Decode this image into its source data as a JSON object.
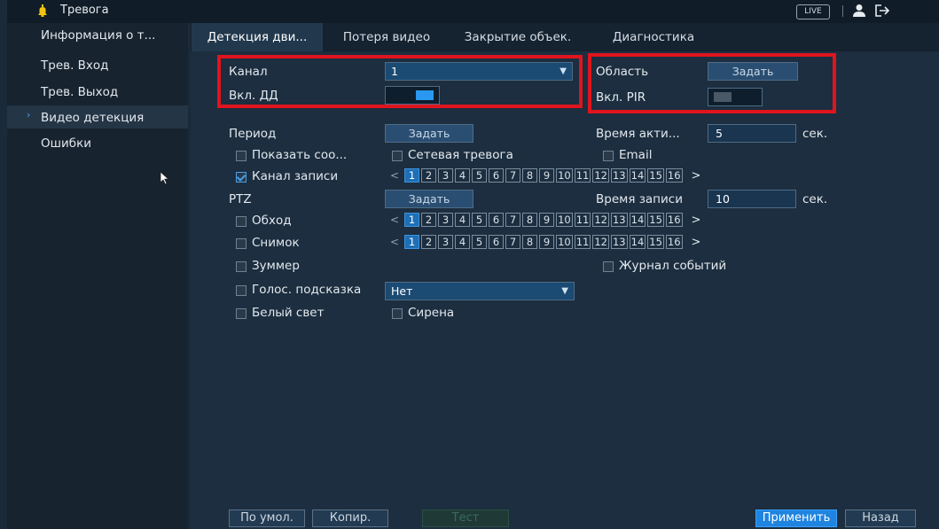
{
  "header": {
    "title": "Тревога",
    "live_label": "LIVE",
    "bell_icon": "bell-icon",
    "user_icon": "user-icon",
    "logout_icon": "logout-icon"
  },
  "sidebar": {
    "items": [
      {
        "label": "Информация о т..."
      },
      {
        "label": "Трев. Вход"
      },
      {
        "label": "Трев. Выход"
      },
      {
        "label": "Видео детекция",
        "active": true
      },
      {
        "label": "Ошибки"
      }
    ]
  },
  "tabs": [
    {
      "label": "Детекция дви...",
      "active": true
    },
    {
      "label": "Потеря видео"
    },
    {
      "label": "Закрытие объек."
    },
    {
      "label": "Диагностика"
    }
  ],
  "form": {
    "channel_label": "Канал",
    "channel_value": "1",
    "md_label": "Вкл. ДД",
    "md_on": true,
    "area_label": "Область",
    "area_button": "Задать",
    "pir_label": "Вкл. PIR",
    "pir_on": false,
    "period_label": "Период",
    "period_button": "Задать",
    "active_time_label": "Время акти...",
    "active_time_value": "5",
    "active_time_unit": "сек.",
    "show_msg_label": "Показать соо...",
    "net_alarm_label": "Сетевая тревога",
    "email_label": "Email",
    "record_channel_label": "Канал записи",
    "ptz_label": "PTZ",
    "ptz_button": "Задать",
    "record_time_label": "Время записи",
    "record_time_value": "10",
    "record_time_unit": "сек.",
    "tour_label": "Обход",
    "snapshot_label": "Снимок",
    "buzzer_label": "Зуммер",
    "event_log_label": "Журнал событий",
    "voice_prompt_label": "Голос. подсказка",
    "voice_prompt_value": "Нет",
    "white_light_label": "Белый свет",
    "siren_label": "Сирена",
    "chip_numbers": [
      "1",
      "2",
      "3",
      "4",
      "5",
      "6",
      "7",
      "8",
      "9",
      "10",
      "11",
      "12",
      "13",
      "14",
      "15",
      "16"
    ],
    "chevron_left": "<",
    "chevron_right": ">"
  },
  "footer": {
    "default_button": "По умол.",
    "copy_button": "Копир.",
    "test_button": "Тест",
    "apply_button": "Применить",
    "back_button": "Назад"
  },
  "colors": {
    "accent": "#1f84e0",
    "highlight_box": "#e0141e",
    "background": "#1a2a38"
  }
}
